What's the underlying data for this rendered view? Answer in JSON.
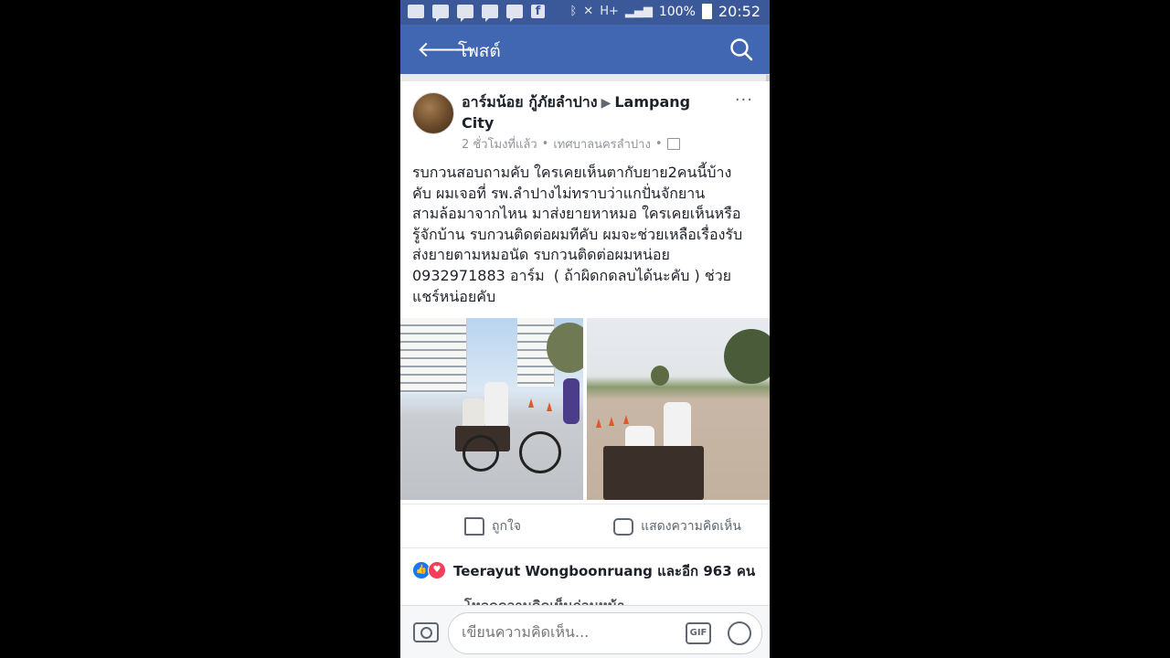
{
  "status_bar": {
    "battery": "100%",
    "time": "20:52",
    "network": "H+"
  },
  "app_bar": {
    "title": "โพสต์"
  },
  "post": {
    "author": "อาร์มน้อย กู้ภัยลำปาง",
    "group": "Lampang City",
    "time_ago": "2 ชั่วโมงที่แล้ว",
    "location": "เทศบาลนครลำปาง",
    "text": "รบกวนสอบถามคับ ใครเคยเห็นตากับยาย2คนนี้บ้าง\nคับ ผมเจอที่ รพ.ลำปางไม่ทราบว่าแกปั่นจักยาน\nสามล้อมาจากไหน มาส่งยายหาหมอ ใครเคยเห็นหรือ\nรู้จักบ้าน รบกวนติดต่อผมทีคับ ผมจะช่วยเหลือเรื่องรับ\nส่งยายตามหมอนัด รบกวนติดต่อผมหน่อย\n0932971883 อาร์ม  ( ถ้าผิดกดลบได้นะคับ ) ช่วย\nแชร์หน่อยคับ",
    "like_label": "ถูกใจ",
    "comment_label": "แสดงความคิดเห็น"
  },
  "reactions": {
    "text": "Teerayut Wongboonruang และอีก 963 คน",
    "previous_comments": "โหลดความคิดเห็นก่อนหน้า"
  },
  "composer": {
    "placeholder": "เขียนความคิดเห็น...",
    "gif_label": "GIF"
  },
  "colors": {
    "status_bar": "#3b5998",
    "app_bar": "#4267b2"
  }
}
